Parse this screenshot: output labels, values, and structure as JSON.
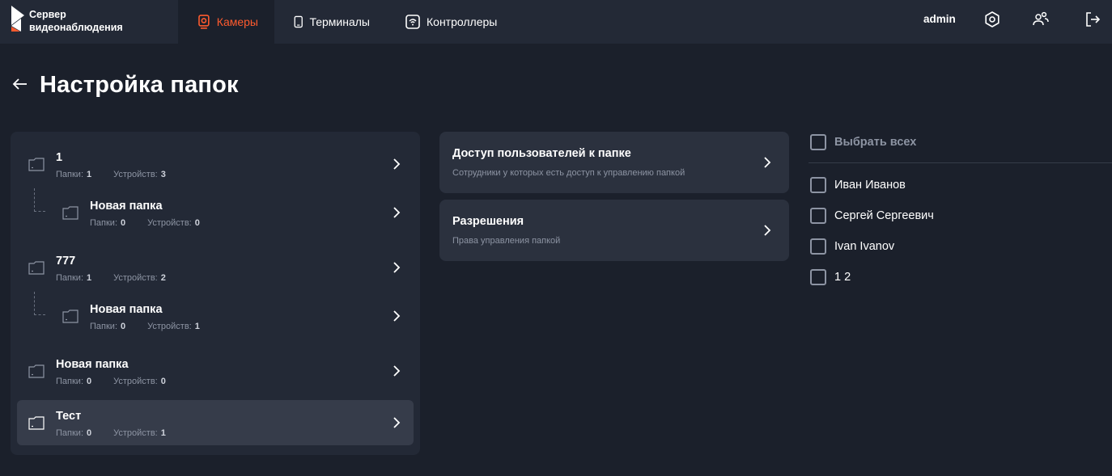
{
  "brand": {
    "line1": "Сервер",
    "line2": "видеонаблюдения",
    "accent": "#ff5b2e"
  },
  "nav": {
    "tabs": [
      {
        "label": "Камеры",
        "icon": "camera-icon",
        "active": true
      },
      {
        "label": "Терминалы",
        "icon": "terminal-icon",
        "active": false
      },
      {
        "label": "Контроллеры",
        "icon": "controller-icon",
        "active": false
      }
    ]
  },
  "header": {
    "user": "admin",
    "icons": [
      "settings-icon",
      "users-icon",
      "logout-icon"
    ]
  },
  "page": {
    "title": "Настройка папок"
  },
  "folders": {
    "folders_label": "Папки:",
    "devices_label": "Устройств:",
    "items": [
      {
        "name": "1",
        "folders": "1",
        "devices": "3",
        "level": 0,
        "selected": false
      },
      {
        "name": "Новая папка",
        "folders": "0",
        "devices": "0",
        "level": 1,
        "selected": false
      },
      {
        "name": "777",
        "folders": "1",
        "devices": "2",
        "level": 0,
        "selected": false
      },
      {
        "name": "Новая папка",
        "folders": "0",
        "devices": "1",
        "level": 1,
        "selected": false
      },
      {
        "name": "Новая папка",
        "folders": "0",
        "devices": "0",
        "level": 0,
        "selected": false
      },
      {
        "name": "Тест",
        "folders": "0",
        "devices": "1",
        "level": 0,
        "selected": true
      }
    ]
  },
  "settings": {
    "access": {
      "title": "Доступ пользователей к папке",
      "subtitle": "Сотрудники у которых есть доступ к управлению папкой"
    },
    "permissions": {
      "title": "Разрешения",
      "subtitle": "Права управления папкой"
    }
  },
  "users": {
    "select_all": "Выбрать всех",
    "items": [
      "Иван Иванов",
      "Сергей Сергеевич",
      "Ivan Ivanov",
      "1 2"
    ]
  }
}
